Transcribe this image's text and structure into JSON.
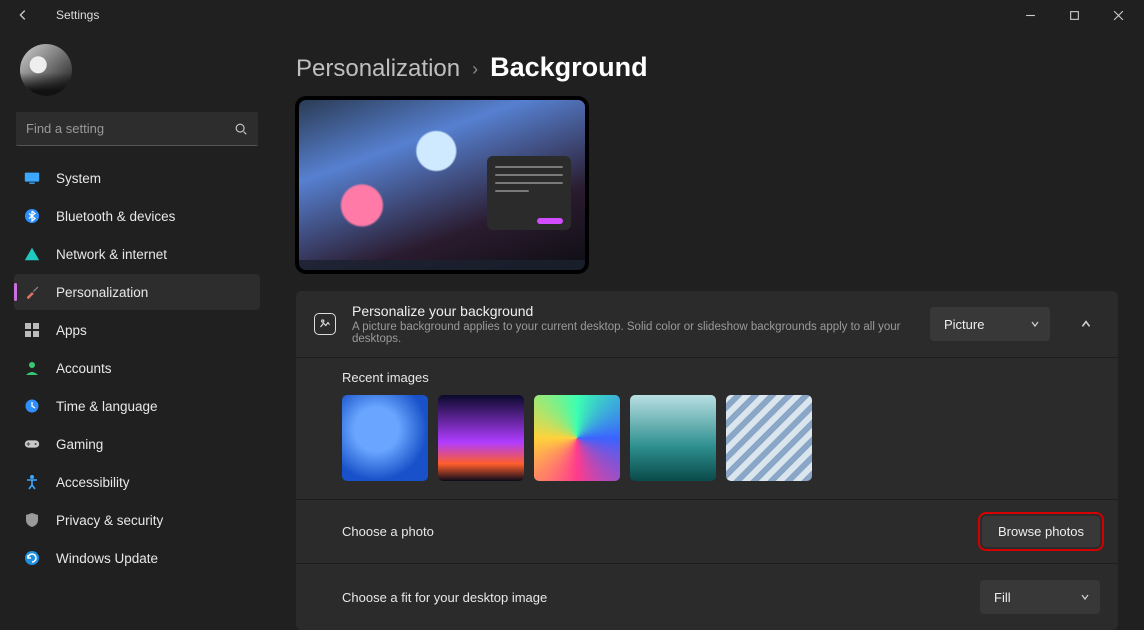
{
  "window": {
    "title": "Settings"
  },
  "search": {
    "placeholder": "Find a setting"
  },
  "sidebar": {
    "items": [
      {
        "label": "System",
        "icon": "monitor-icon"
      },
      {
        "label": "Bluetooth & devices",
        "icon": "bluetooth-icon"
      },
      {
        "label": "Network & internet",
        "icon": "wifi-icon"
      },
      {
        "label": "Personalization",
        "icon": "brush-icon"
      },
      {
        "label": "Apps",
        "icon": "apps-icon"
      },
      {
        "label": "Accounts",
        "icon": "person-icon"
      },
      {
        "label": "Time & language",
        "icon": "clock-icon"
      },
      {
        "label": "Gaming",
        "icon": "gamepad-icon"
      },
      {
        "label": "Accessibility",
        "icon": "accessibility-icon"
      },
      {
        "label": "Privacy & security",
        "icon": "shield-icon"
      },
      {
        "label": "Windows Update",
        "icon": "update-icon"
      }
    ],
    "selected_index": 3
  },
  "breadcrumb": {
    "parent": "Personalization",
    "current": "Background"
  },
  "background_card": {
    "title": "Personalize your background",
    "description": "A picture background applies to your current desktop. Solid color or slideshow backgrounds apply to all your desktops.",
    "type_select": {
      "value": "Picture"
    },
    "recent_label": "Recent images",
    "choose_photo": {
      "label": "Choose a photo",
      "button": "Browse photos"
    },
    "fit": {
      "label": "Choose a fit for your desktop image",
      "value": "Fill"
    }
  }
}
